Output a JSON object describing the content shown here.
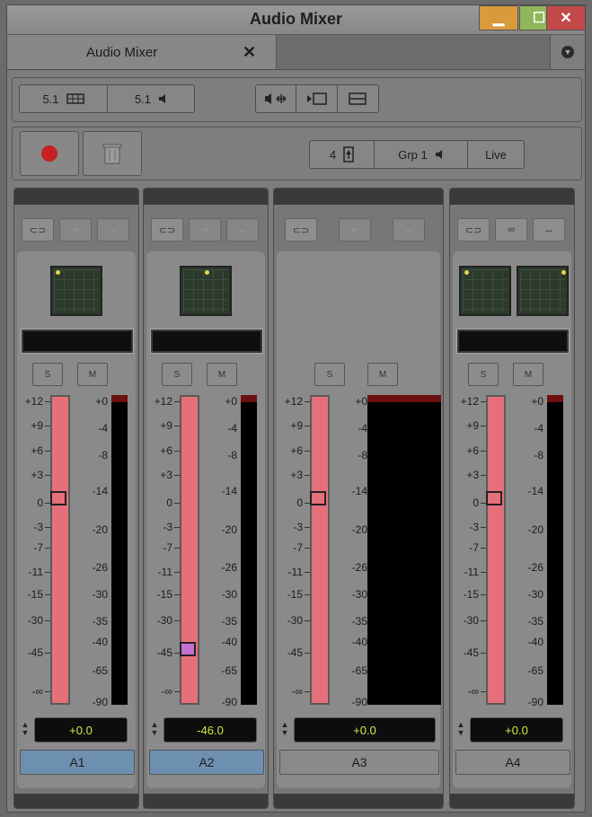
{
  "window": {
    "title": "Audio Mixer"
  },
  "tab": {
    "label": "Audio Mixer",
    "close_glyph": "✕"
  },
  "toolbar": {
    "format_left": "5.1",
    "format_right": "5.1",
    "bank_number": "4",
    "group_label": "Grp 1",
    "live_label": "Live"
  },
  "strip_labels": {
    "solo": "S",
    "mute": "M"
  },
  "gain_scale": [
    "+12",
    "+9",
    "+6",
    "+3",
    "0",
    "-3",
    "-7",
    "-11",
    "-15",
    "-30",
    "-45",
    "-∞"
  ],
  "vu_scale": [
    "+0",
    "-4",
    "-8",
    "-14",
    "-20",
    "-26",
    "-30",
    "-35",
    "-40",
    "-65",
    "-90"
  ],
  "tracks": [
    {
      "name": "A1",
      "gain": "+0.0",
      "level_db": 0,
      "selected": true,
      "color": "#e6707a"
    },
    {
      "name": "A2",
      "gain": "-46.0",
      "level_db": -46,
      "selected": true,
      "color": "#e6707a"
    },
    {
      "name": "A3",
      "gain": "+0.0",
      "level_db": 0,
      "selected": false,
      "color": "#e6707a"
    },
    {
      "name": "A4",
      "gain": "+0.0",
      "level_db": 0,
      "selected": false,
      "color": "#e6707a"
    }
  ],
  "colors": {
    "record": "#c62020",
    "knob": "#e6707a",
    "knob_active": "#c56fd0",
    "value_text": "#d9e84a"
  }
}
